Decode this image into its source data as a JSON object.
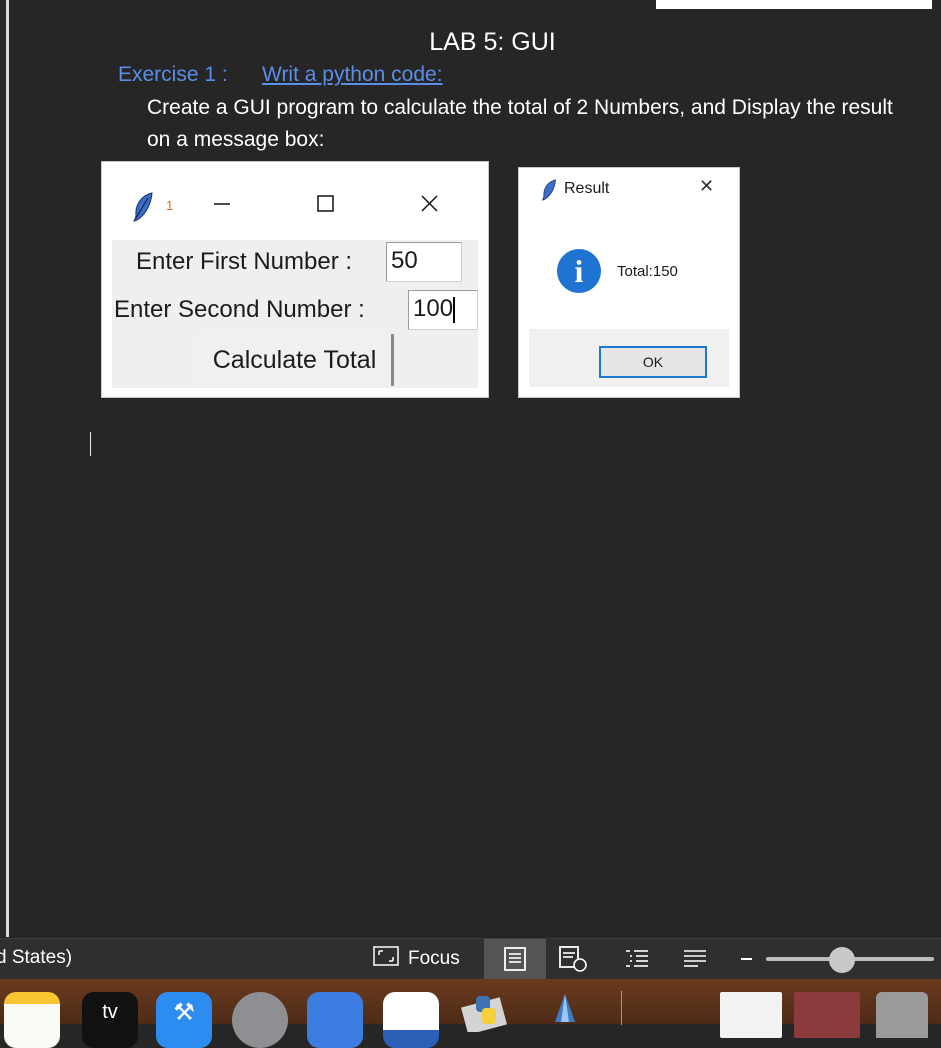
{
  "document": {
    "title": "LAB 5: GUI",
    "exercise_label": "Exercise 1 :",
    "exercise_link": "Writ a python code:",
    "instructions": "Create a GUI program to calculate the total of 2 Numbers, and Display the result on a message box:"
  },
  "tk_window": {
    "title": "1",
    "icons": [
      "feather-icon",
      "minimize-icon",
      "maximize-icon",
      "close-icon"
    ],
    "first_label": "Enter First Number :",
    "first_value": "50",
    "second_label": "Enter Second Number :",
    "second_value": "100",
    "button_label": "Calculate Total"
  },
  "message_box": {
    "title": "Result",
    "message": "Total:150",
    "ok_label": "OK",
    "icons": [
      "feather-icon",
      "info-icon",
      "close-icon"
    ]
  },
  "status_bar": {
    "language": "d States)",
    "focus_label": "Focus",
    "view_icons": [
      "print-layout-icon",
      "web-layout-icon",
      "outline-icon",
      "draft-icon"
    ],
    "zoom_level": 0.45
  },
  "dock": {
    "apps": [
      "notes-icon",
      "apple-tv-icon",
      "xcode-icon",
      "system-preferences-icon",
      "script-editor-icon",
      "word-icon",
      "python-launcher-icon",
      "ink-pen-icon",
      "window-preview-icon",
      "document-preview-icon",
      "trash-icon"
    ],
    "tv_label": "tv"
  },
  "colors": {
    "background": "#262626",
    "link": "#5a8ee8",
    "info_icon": "#1f73d1",
    "ok_border": "#1e77d3"
  }
}
